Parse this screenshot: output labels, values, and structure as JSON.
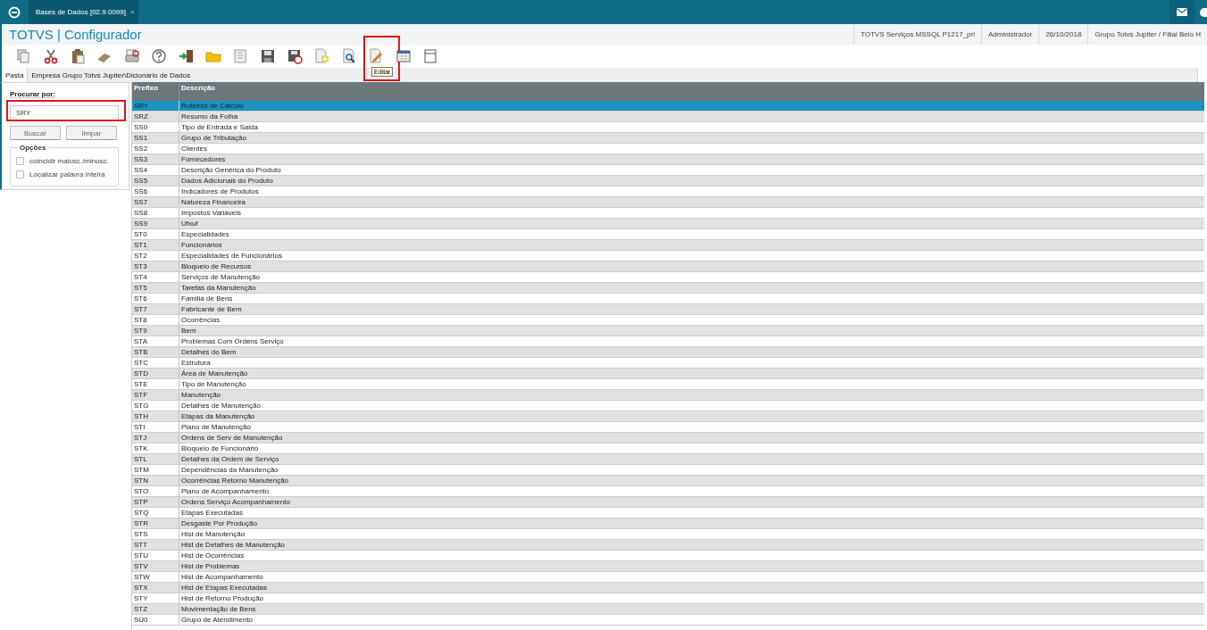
{
  "window": {
    "tab_title": "Bases de Dados [02.9.0099]",
    "tab_close": "×"
  },
  "app_header": {
    "title": "TOTVS | Configurador",
    "info": [
      "TOTVS Serviços MSSQL P1217_pri",
      "Administrador",
      "26/10/2018",
      "Grupo Totvs Jupiter / Filial Belo H"
    ]
  },
  "toolbar": {
    "tooltip": {
      "text": "Editar",
      "highlighted": true
    }
  },
  "breadcrumb": {
    "label": "Pasta",
    "path": "Empresa Grupo Totvs Jupiter\\Dicionário de Dados"
  },
  "search": {
    "label": "Procurar por:",
    "value": "SRY",
    "highlighted": true,
    "buttons": [
      "Buscar",
      "limpar"
    ],
    "options_title": "Opções",
    "options": [
      {
        "label": "coincidir maiusc./minusc.",
        "checked": false
      },
      {
        "label": "Localizar palavra inteira",
        "checked": false
      }
    ]
  },
  "table": {
    "columns": [
      "Prefixo",
      "Descrição"
    ],
    "rows": [
      {
        "cells": [
          "SRY",
          "Roteiros de Cálculo"
        ],
        "selected": true
      },
      {
        "cells": [
          "SRZ",
          "Resumo da Folha"
        ],
        "selected": false
      },
      {
        "cells": [
          "SS0",
          "Tipo de Entrada e Saida"
        ],
        "selected": false
      },
      {
        "cells": [
          "SS1",
          "Grupo de Tributação"
        ],
        "selected": false
      },
      {
        "cells": [
          "SS2",
          "Clientes"
        ],
        "selected": false
      },
      {
        "cells": [
          "SS3",
          "Fornecedores"
        ],
        "selected": false
      },
      {
        "cells": [
          "SS4",
          "Descrição Genérica do Produto"
        ],
        "selected": false
      },
      {
        "cells": [
          "SS5",
          "Dados Adicionais do Produto"
        ],
        "selected": false
      },
      {
        "cells": [
          "SS6",
          "Indicadores de Produtos"
        ],
        "selected": false
      },
      {
        "cells": [
          "SS7",
          "Natureza Financeira"
        ],
        "selected": false
      },
      {
        "cells": [
          "SS8",
          "Impostos Variaveis"
        ],
        "selected": false
      },
      {
        "cells": [
          "SS9",
          "Ufxuf"
        ],
        "selected": false
      },
      {
        "cells": [
          "ST0",
          "Especialidades"
        ],
        "selected": false
      },
      {
        "cells": [
          "ST1",
          "Funcionários"
        ],
        "selected": false
      },
      {
        "cells": [
          "ST2",
          "Especialidades de Funcionários"
        ],
        "selected": false
      },
      {
        "cells": [
          "ST3",
          "Bloqueio de Recursos"
        ],
        "selected": false
      },
      {
        "cells": [
          "ST4",
          "Serviços de Manutenção"
        ],
        "selected": false
      },
      {
        "cells": [
          "ST5",
          "Tarefas da Manutenção"
        ],
        "selected": false
      },
      {
        "cells": [
          "ST6",
          "Familia de Bens"
        ],
        "selected": false
      },
      {
        "cells": [
          "ST7",
          "Fabricante de Bem"
        ],
        "selected": false
      },
      {
        "cells": [
          "ST8",
          "Ocorrências"
        ],
        "selected": false
      },
      {
        "cells": [
          "ST9",
          "Bem"
        ],
        "selected": false
      },
      {
        "cells": [
          "STA",
          "Problemas Com Ordens Serviço"
        ],
        "selected": false
      },
      {
        "cells": [
          "STB",
          "Detalhes do Bem"
        ],
        "selected": false
      },
      {
        "cells": [
          "STC",
          "Estrutura"
        ],
        "selected": false
      },
      {
        "cells": [
          "STD",
          "Área de Manutenção"
        ],
        "selected": false
      },
      {
        "cells": [
          "STE",
          "Tipo de Manutenção"
        ],
        "selected": false
      },
      {
        "cells": [
          "STF",
          "Manutenção"
        ],
        "selected": false
      },
      {
        "cells": [
          "STG",
          "Detalhes de Manutenção"
        ],
        "selected": false
      },
      {
        "cells": [
          "STH",
          "Etapas da Manutenção"
        ],
        "selected": false
      },
      {
        "cells": [
          "STI",
          "Plano de Manutenção"
        ],
        "selected": false
      },
      {
        "cells": [
          "STJ",
          "Ordens de Serv de Manutenção"
        ],
        "selected": false
      },
      {
        "cells": [
          "STK",
          "Bloqueio de Funcionário"
        ],
        "selected": false
      },
      {
        "cells": [
          "STL",
          "Detalhes da Ordem de Serviço"
        ],
        "selected": false
      },
      {
        "cells": [
          "STM",
          "Dependências da Manutenção"
        ],
        "selected": false
      },
      {
        "cells": [
          "STN",
          "Ocorrências Retorno Manutenção"
        ],
        "selected": false
      },
      {
        "cells": [
          "STO",
          "Plano de Acompanhamento"
        ],
        "selected": false
      },
      {
        "cells": [
          "STP",
          "Ordens Serviço Acompanhamento"
        ],
        "selected": false
      },
      {
        "cells": [
          "STQ",
          "Etapas Executadas"
        ],
        "selected": false
      },
      {
        "cells": [
          "STR",
          "Desgaste Por Produção"
        ],
        "selected": false
      },
      {
        "cells": [
          "STS",
          "Hist de Manutenção"
        ],
        "selected": false
      },
      {
        "cells": [
          "STT",
          "Hist de Detalhes de Manutenção"
        ],
        "selected": false
      },
      {
        "cells": [
          "STU",
          "Hist de Ocorrências"
        ],
        "selected": false
      },
      {
        "cells": [
          "STV",
          "Hist de Problemas"
        ],
        "selected": false
      },
      {
        "cells": [
          "STW",
          "Hist de Acompanhamento"
        ],
        "selected": false
      },
      {
        "cells": [
          "STX",
          "Hist de Etapas Executadas"
        ],
        "selected": false
      },
      {
        "cells": [
          "STY",
          "Hist de Retorno Produção"
        ],
        "selected": false
      },
      {
        "cells": [
          "STZ",
          "Movimentação de Bens"
        ],
        "selected": false
      },
      {
        "cells": [
          "SU0",
          "Grupo de Atendimento"
        ],
        "selected": false
      }
    ]
  }
}
